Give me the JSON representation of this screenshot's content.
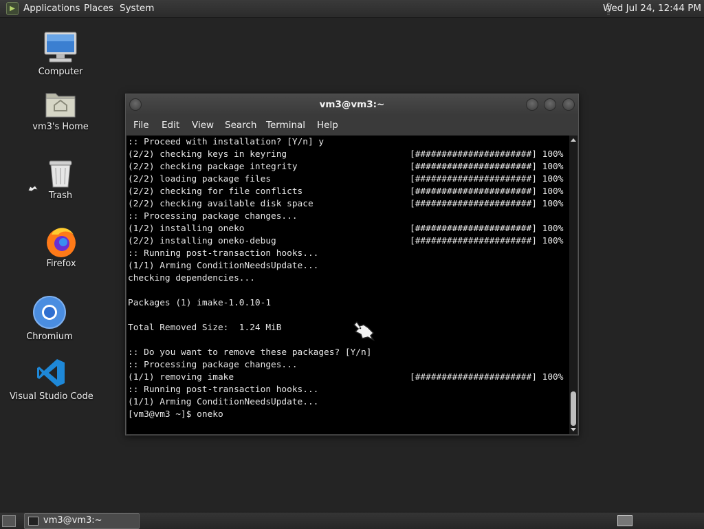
{
  "top_panel": {
    "menus": [
      "Applications",
      "Places",
      "System"
    ],
    "clock": "Wed Jul 24, 12:44 PM"
  },
  "desktop_icons": [
    {
      "label": "Computer",
      "icon": "computer-icon"
    },
    {
      "label": "vm3's Home",
      "icon": "home-folder-icon"
    },
    {
      "label": "Trash",
      "icon": "trash-icon"
    },
    {
      "label": "Firefox",
      "icon": "firefox-icon"
    },
    {
      "label": "Chromium",
      "icon": "chromium-icon"
    },
    {
      "label": "Visual Studio Code",
      "icon": "vscode-icon"
    }
  ],
  "terminal": {
    "title": "vm3@vm3:~",
    "menus": [
      "File",
      "Edit",
      "View",
      "Search",
      "Terminal",
      "Help"
    ],
    "lines": [
      {
        "text": ":: Proceed with installation? [Y/n] y",
        "bar": ""
      },
      {
        "text": "(2/2) checking keys in keyring",
        "bar": "[######################] 100%"
      },
      {
        "text": "(2/2) checking package integrity",
        "bar": "[######################] 100%"
      },
      {
        "text": "(2/2) loading package files",
        "bar": "[######################] 100%"
      },
      {
        "text": "(2/2) checking for file conflicts",
        "bar": "[######################] 100%"
      },
      {
        "text": "(2/2) checking available disk space",
        "bar": "[######################] 100%"
      },
      {
        "text": ":: Processing package changes...",
        "bar": ""
      },
      {
        "text": "(1/2) installing oneko",
        "bar": "[######################] 100%"
      },
      {
        "text": "(2/2) installing oneko-debug",
        "bar": "[######################] 100%"
      },
      {
        "text": ":: Running post-transaction hooks...",
        "bar": ""
      },
      {
        "text": "(1/1) Arming ConditionNeedsUpdate...",
        "bar": ""
      },
      {
        "text": "checking dependencies...",
        "bar": ""
      },
      {
        "text": "",
        "bar": ""
      },
      {
        "text": "Packages (1) imake-1.0.10-1",
        "bar": ""
      },
      {
        "text": "",
        "bar": ""
      },
      {
        "text": "Total Removed Size:  1.24 MiB",
        "bar": ""
      },
      {
        "text": "",
        "bar": ""
      },
      {
        "text": ":: Do you want to remove these packages? [Y/n]",
        "bar": ""
      },
      {
        "text": ":: Processing package changes...",
        "bar": ""
      },
      {
        "text": "(1/1) removing imake",
        "bar": "[######################] 100%"
      },
      {
        "text": ":: Running post-transaction hooks...",
        "bar": ""
      },
      {
        "text": "(1/1) Arming ConditionNeedsUpdate...",
        "bar": ""
      },
      {
        "text": "[vm3@vm3 ~]$ oneko",
        "bar": ""
      }
    ]
  },
  "taskbar": {
    "task_label": "vm3@vm3:~"
  }
}
